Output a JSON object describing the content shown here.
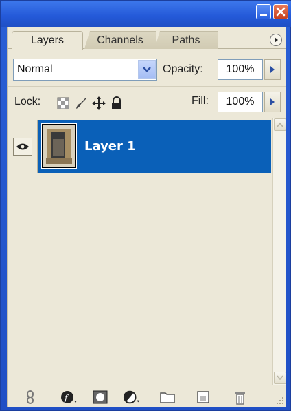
{
  "tabs": [
    {
      "label": "Layers"
    },
    {
      "label": "Channels"
    },
    {
      "label": "Paths"
    }
  ],
  "blend_mode": {
    "value": "Normal"
  },
  "opacity": {
    "label": "Opacity:",
    "value": "100%"
  },
  "lock": {
    "label": "Lock:",
    "icons": [
      "lock-transparent-pixels-icon",
      "lock-image-pixels-icon",
      "lock-position-icon",
      "lock-all-icon"
    ]
  },
  "fill": {
    "label": "Fill:",
    "value": "100%"
  },
  "layers": [
    {
      "name": "Layer 1",
      "visible": true,
      "selected": true
    }
  ],
  "bottom_icons": [
    "link-layers-icon",
    "layer-style-icon",
    "layer-mask-icon",
    "adjustment-layer-icon",
    "new-group-icon",
    "new-layer-icon",
    "trash-icon"
  ],
  "colors": {
    "title_bar": "#2459d8",
    "panel_bg": "#ece8d8",
    "selection": "#0a60b8",
    "close_button": "#c8401e"
  }
}
